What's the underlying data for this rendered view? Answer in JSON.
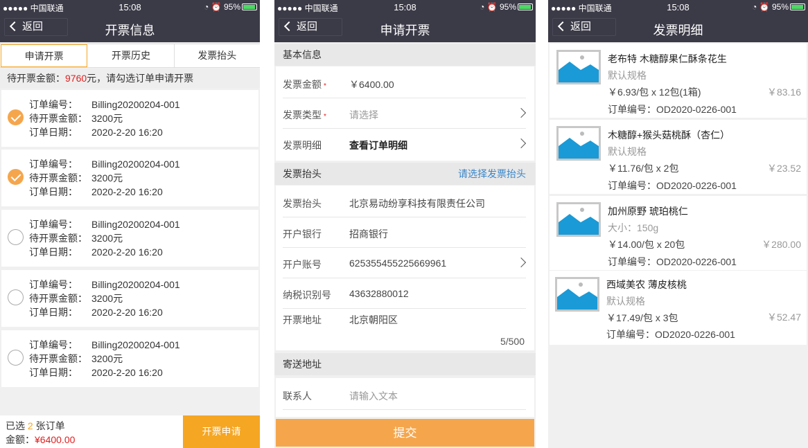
{
  "status": {
    "carrier": "●●●●● 中国联通",
    "wifi": "ᯤ",
    "time": "15:08",
    "icons": "◔ ⏰",
    "battery": "95%"
  },
  "back_label": "返回",
  "screen1": {
    "title": "开票信息",
    "tabs": [
      "申请开票",
      "开票历史",
      "发票抬头"
    ],
    "hint_prefix": "待开票金额：",
    "hint_amount": "9760",
    "hint_suffix": "元，请勾选订单申请开票",
    "order_label_no": "订单编号：",
    "order_label_amt": "待开票金额：",
    "order_label_date": "订单日期：",
    "orders": [
      {
        "no": "Billing20200204-001",
        "amount": "3200元",
        "date": "2020-2-20 16:20",
        "checked": true
      },
      {
        "no": "Billing20200204-001",
        "amount": "3200元",
        "date": "2020-2-20 16:20",
        "checked": true
      },
      {
        "no": "Billing20200204-001",
        "amount": "3200元",
        "date": "2020-2-20 16:20",
        "checked": false
      },
      {
        "no": "Billing20200204-001",
        "amount": "3200元",
        "date": "2020-2-20 16:20",
        "checked": false
      },
      {
        "no": "Billing20200204-001",
        "amount": "3200元",
        "date": "2020-2-20 16:20",
        "checked": false
      }
    ],
    "footer": {
      "sel_prefix": "已选 ",
      "sel_count": "2",
      "sel_suffix": " 张订单",
      "amt_label": "金额：",
      "amt_value": "¥6400.00",
      "button": "开票申请"
    }
  },
  "screen2": {
    "title": "申请开票",
    "section_basic": "基本信息",
    "amount_label": "发票金额",
    "amount_value": "￥6400.00",
    "type_label": "发票类型",
    "type_placeholder": "请选择",
    "detail_label": "发票明细",
    "detail_value": "查看订单明细",
    "section_header": "发票抬头",
    "header_link": "请选择发票抬头",
    "header_label": "发票抬头",
    "header_value": "北京易动纷享科技有限责任公司",
    "bank_label": "开户银行",
    "bank_value": "招商银行",
    "account_label": "开户账号",
    "account_value": "625355455225669961",
    "tax_label": "纳税识别号",
    "tax_value": "43632880012",
    "addr_label": "开票地址",
    "addr_value": "北京朝阳区",
    "addr_counter": "5/500",
    "section_mail": "寄送地址",
    "contact_label": "联系人",
    "contact_placeholder": "请输入文本",
    "submit": "提交"
  },
  "screen3": {
    "title": "发票明细",
    "order_prefix": "订单编号：",
    "items": [
      {
        "name": "老布特 木糖醇果仁酥条花生",
        "spec": "默认规格",
        "price": "￥6.93/包 x 12包(1箱)",
        "total": "￥83.16",
        "order": "OD2020-0226-001"
      },
      {
        "name": "木糖醇+猴头菇桃酥（杏仁）",
        "spec": "默认规格",
        "price": "￥11.76/包 x 2包",
        "total": "￥23.52",
        "order": "OD2020-0226-001"
      },
      {
        "name": "加州原野 琥珀桃仁",
        "spec": "大小：150g",
        "price": "￥14.00/包 x 20包",
        "total": "￥280.00",
        "order": "OD2020-0226-001"
      },
      {
        "name": "西域美农 薄皮核桃",
        "spec": "默认规格",
        "price": "￥17.49/包 x 3包",
        "total": "￥52.47",
        "order": "OD2020-0226-001"
      }
    ]
  }
}
